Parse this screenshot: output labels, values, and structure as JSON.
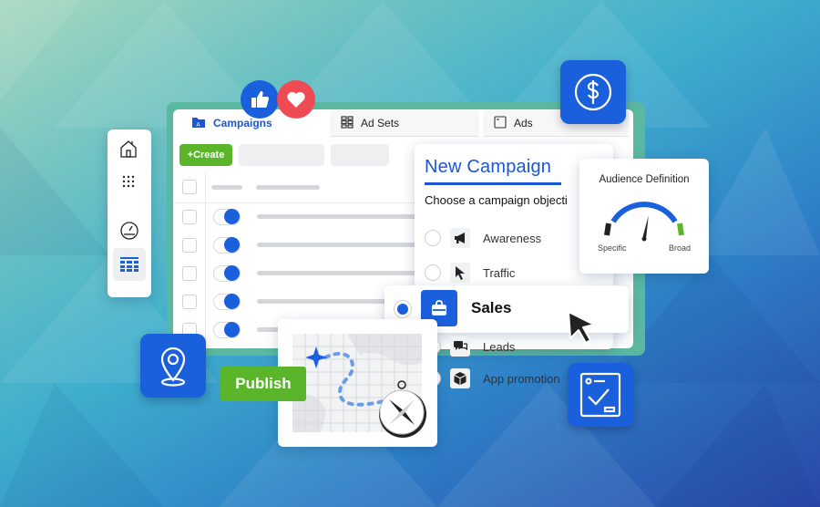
{
  "tabs": [
    {
      "label": "Campaigns",
      "icon": "folder-icon",
      "active": true
    },
    {
      "label": "Ad Sets",
      "icon": "grid-icon",
      "active": false
    },
    {
      "label": "Ads",
      "icon": "window-icon",
      "active": false
    }
  ],
  "toolbar": {
    "create_label": "+Create"
  },
  "table": {
    "rows": 5,
    "toggles_on": [
      true,
      true,
      true,
      true,
      true
    ]
  },
  "sidebar": {
    "items": [
      {
        "icon": "home-icon"
      },
      {
        "icon": "apps-icon"
      },
      {
        "icon": "gauge-icon"
      },
      {
        "icon": "table-icon",
        "active": true
      }
    ]
  },
  "new_campaign": {
    "title": "New Campaign",
    "subtitle": "Choose a campaign objecti",
    "options": [
      {
        "label": "Awareness",
        "icon": "megaphone-icon",
        "selected": false
      },
      {
        "label": "Traffic",
        "icon": "cursor-icon",
        "selected": false
      },
      {
        "label": "Sales",
        "icon": "shopping-bag-icon",
        "selected": true
      },
      {
        "label": "Leads",
        "icon": "chat-icon",
        "selected": false
      },
      {
        "label": "App promotion",
        "icon": "cube-icon",
        "selected": false
      }
    ]
  },
  "audience": {
    "title": "Audience Definition",
    "left_label": "Specific",
    "right_label": "Broad",
    "needle_fraction": 0.62
  },
  "publish_label": "Publish",
  "reactions": [
    "like-icon",
    "heart-icon"
  ],
  "tiles": [
    "dollar-icon",
    "location-pin-icon",
    "checklist-icon"
  ],
  "colors": {
    "accent": "#1a5fdc",
    "green": "#5ab52a",
    "heart": "#f04b55"
  }
}
